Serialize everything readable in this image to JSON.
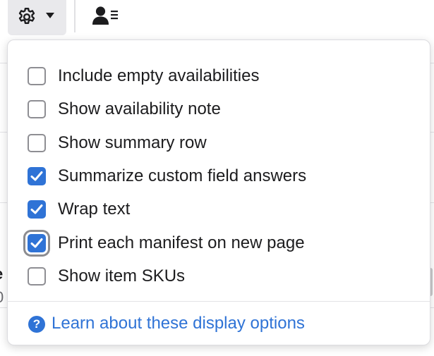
{
  "toolbar": {
    "settings_icon": "gear-icon",
    "dropdown_icon": "caret-down-icon",
    "manifest_icon": "person-list-icon"
  },
  "background": {
    "row_label_fragment": "e",
    "row_value_fragment": "0"
  },
  "display_options": {
    "items": [
      {
        "label": "Include empty availabilities",
        "checked": false,
        "focused": false
      },
      {
        "label": "Show availability note",
        "checked": false,
        "focused": false
      },
      {
        "label": "Show summary row",
        "checked": false,
        "focused": false
      },
      {
        "label": "Summarize custom field answers",
        "checked": true,
        "focused": false
      },
      {
        "label": "Wrap text",
        "checked": true,
        "focused": false
      },
      {
        "label": "Print each manifest on new page",
        "checked": true,
        "focused": true
      },
      {
        "label": "Show item SKUs",
        "checked": false,
        "focused": false
      }
    ],
    "help_icon": "question-circle-icon",
    "help_glyph": "?",
    "help_link_label": "Learn about these display options"
  },
  "colors": {
    "accent": "#2f73d6",
    "button_bg": "#e9e9ec",
    "checkbox_border": "#8e8e93"
  }
}
